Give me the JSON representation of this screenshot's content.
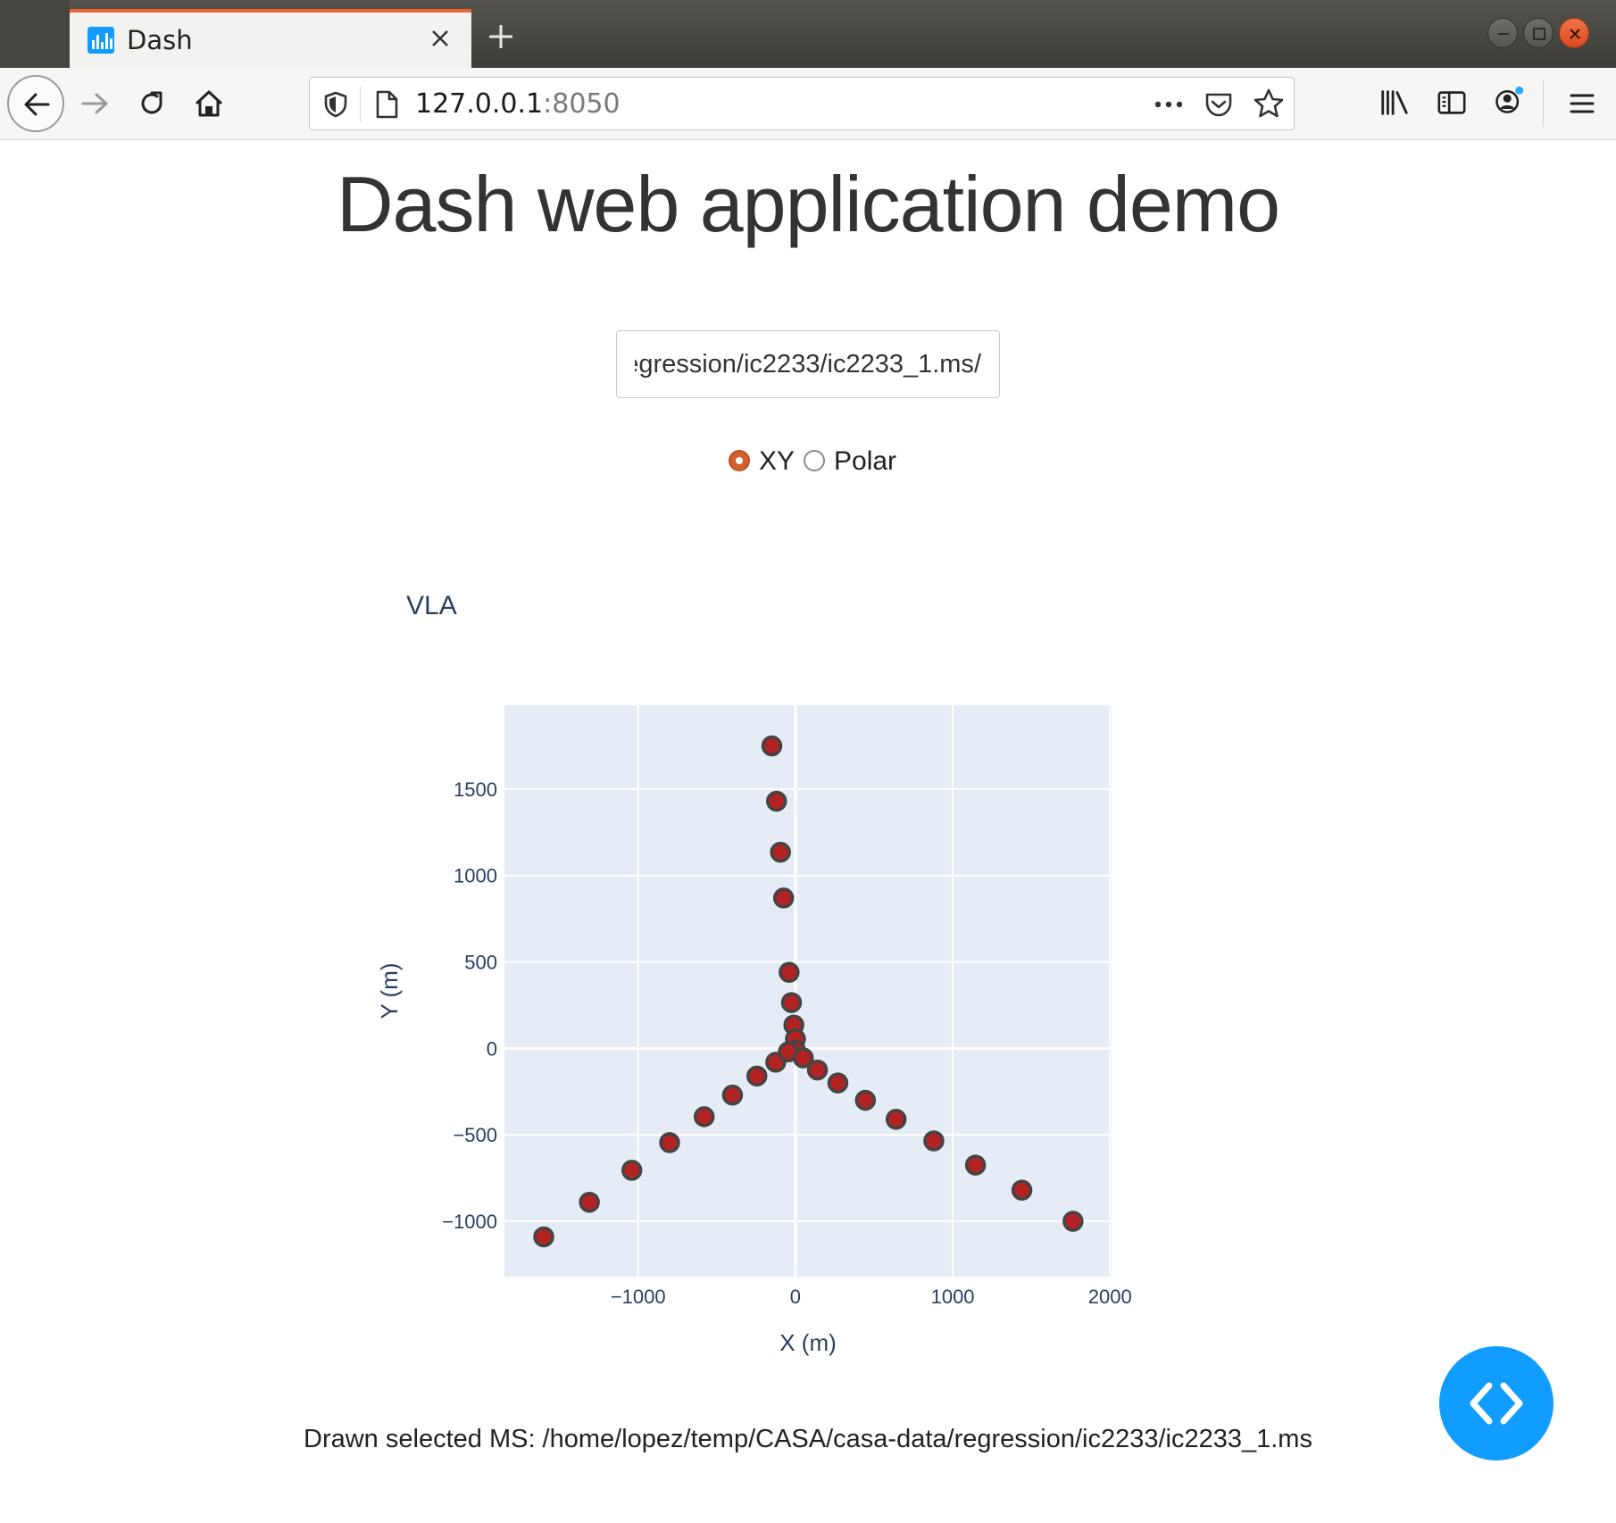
{
  "browser": {
    "tab_title": "Dash",
    "url_host": "127.0.0.1",
    "url_port": ":8050"
  },
  "page": {
    "title": "Dash web application demo",
    "ms_input_value": "/home/lopez/temp/CASA/casa-data/regression/ic2233/ic2233_1.ms",
    "radio_options": [
      {
        "label": "XY",
        "selected": true
      },
      {
        "label": "Polar",
        "selected": false
      }
    ],
    "footer": "Drawn selected MS: /home/lopez/temp/CASA/casa-data/regression/ic2233/ic2233_1.ms"
  },
  "colors": {
    "accent": "#119dff",
    "marker_fill": "#b22222",
    "marker_line": "#444444",
    "plot_bg": "#e5ecf6",
    "axis_text": "#2a3f5f",
    "radio_selected": "#d35f2f"
  },
  "chart_data": {
    "type": "scatter",
    "title": "VLA",
    "xlabel": "X (m)",
    "ylabel": "Y (m)",
    "xlim": [
      -1850,
      2010
    ],
    "ylim": [
      -1320,
      1985
    ],
    "xticks": [
      -1000,
      0,
      1000,
      2000
    ],
    "xtick_labels": [
      "−1000",
      "0",
      "1000",
      "2000"
    ],
    "yticks": [
      -1000,
      -500,
      0,
      500,
      1000,
      1500
    ],
    "ytick_labels": [
      "−1000",
      "−500",
      "0",
      "500",
      "1000",
      "1500"
    ],
    "grid": true,
    "series": [
      {
        "x": [
          -150,
          -120,
          -95,
          -75,
          -40,
          -25,
          -10,
          0,
          0,
          -1600,
          -1310,
          -1040,
          -800,
          -580,
          -400,
          -245,
          -125,
          -45,
          50,
          140,
          270,
          445,
          640,
          880,
          1145,
          1440,
          1765
        ],
        "y": [
          1750,
          1430,
          1135,
          870,
          440,
          265,
          135,
          55,
          -10,
          -1090,
          -890,
          -705,
          -545,
          -395,
          -270,
          -160,
          -80,
          -20,
          -55,
          -125,
          -200,
          -300,
          -410,
          -535,
          -675,
          -820,
          -1000
        ]
      }
    ]
  }
}
